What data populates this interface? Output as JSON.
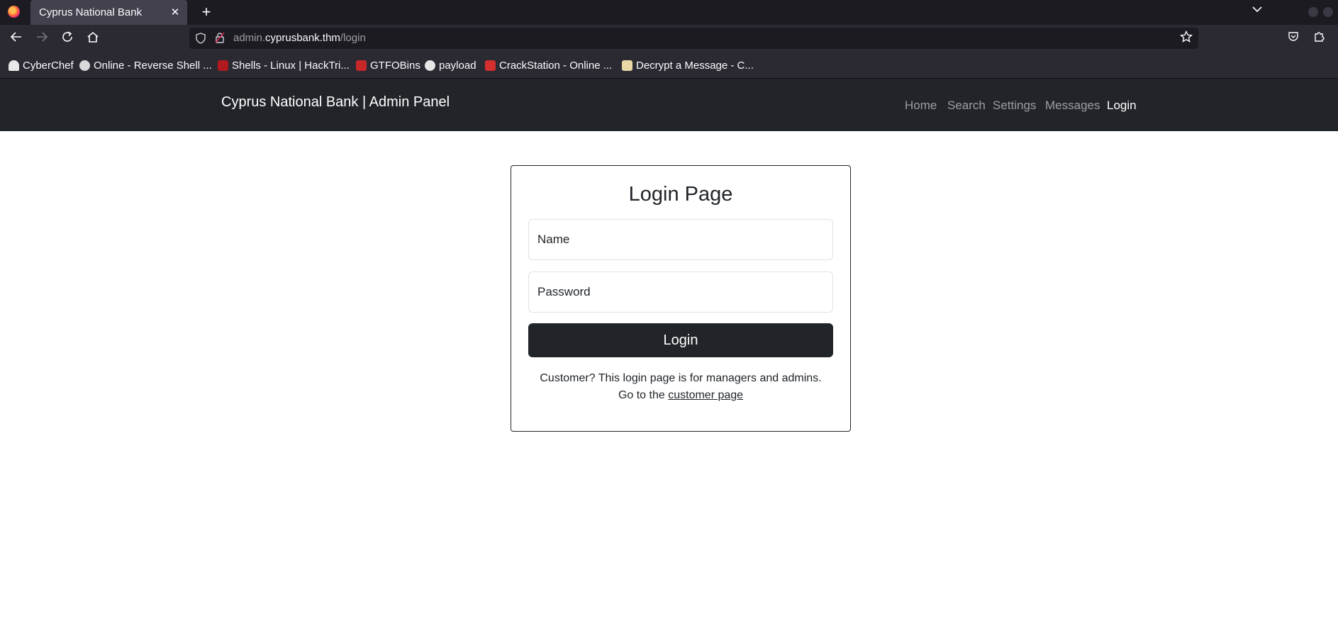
{
  "browser": {
    "tab_title": "Cyprus National Bank",
    "tab_close": "✕",
    "new_tab": "+",
    "url": {
      "subdomain": "admin.",
      "domain": "cyprusbank.thm",
      "path": "/login"
    },
    "bookmarks": [
      {
        "label": "CyberChef",
        "icon": "chef-hat-icon",
        "color": "#e8e8e8"
      },
      {
        "label": "Online - Reverse Shell ...",
        "icon": "skull-icon",
        "color": "#d9d9d9"
      },
      {
        "label": "Shells - Linux | HackTri...",
        "icon": "hacktricks-icon",
        "color": "#b0191f"
      },
      {
        "label": "GTFOBins",
        "icon": "gtfobins-icon",
        "color": "#c62828"
      },
      {
        "label": "payload",
        "icon": "github-icon",
        "color": "#e6e6e6"
      },
      {
        "label": "CrackStation - Online ...",
        "icon": "crackstation-icon",
        "color": "#d32f2f"
      },
      {
        "label": "Decrypt a Message - C...",
        "icon": "envelope-icon",
        "color": "#e9d8a6"
      }
    ]
  },
  "site": {
    "brand": "Cyprus National Bank | Admin Panel",
    "nav": [
      {
        "label": "Home",
        "active": false
      },
      {
        "label": "Search",
        "active": false
      },
      {
        "label": "Settings",
        "active": false
      },
      {
        "label": "Messages",
        "active": false
      },
      {
        "label": "Login",
        "active": true
      }
    ]
  },
  "login": {
    "title": "Login Page",
    "name_placeholder": "Name",
    "password_placeholder": "Password",
    "button": "Login",
    "help_line1": "Customer? This login page is for managers and admins.",
    "help_prefix": "Go to the",
    "help_link": "customer page"
  }
}
